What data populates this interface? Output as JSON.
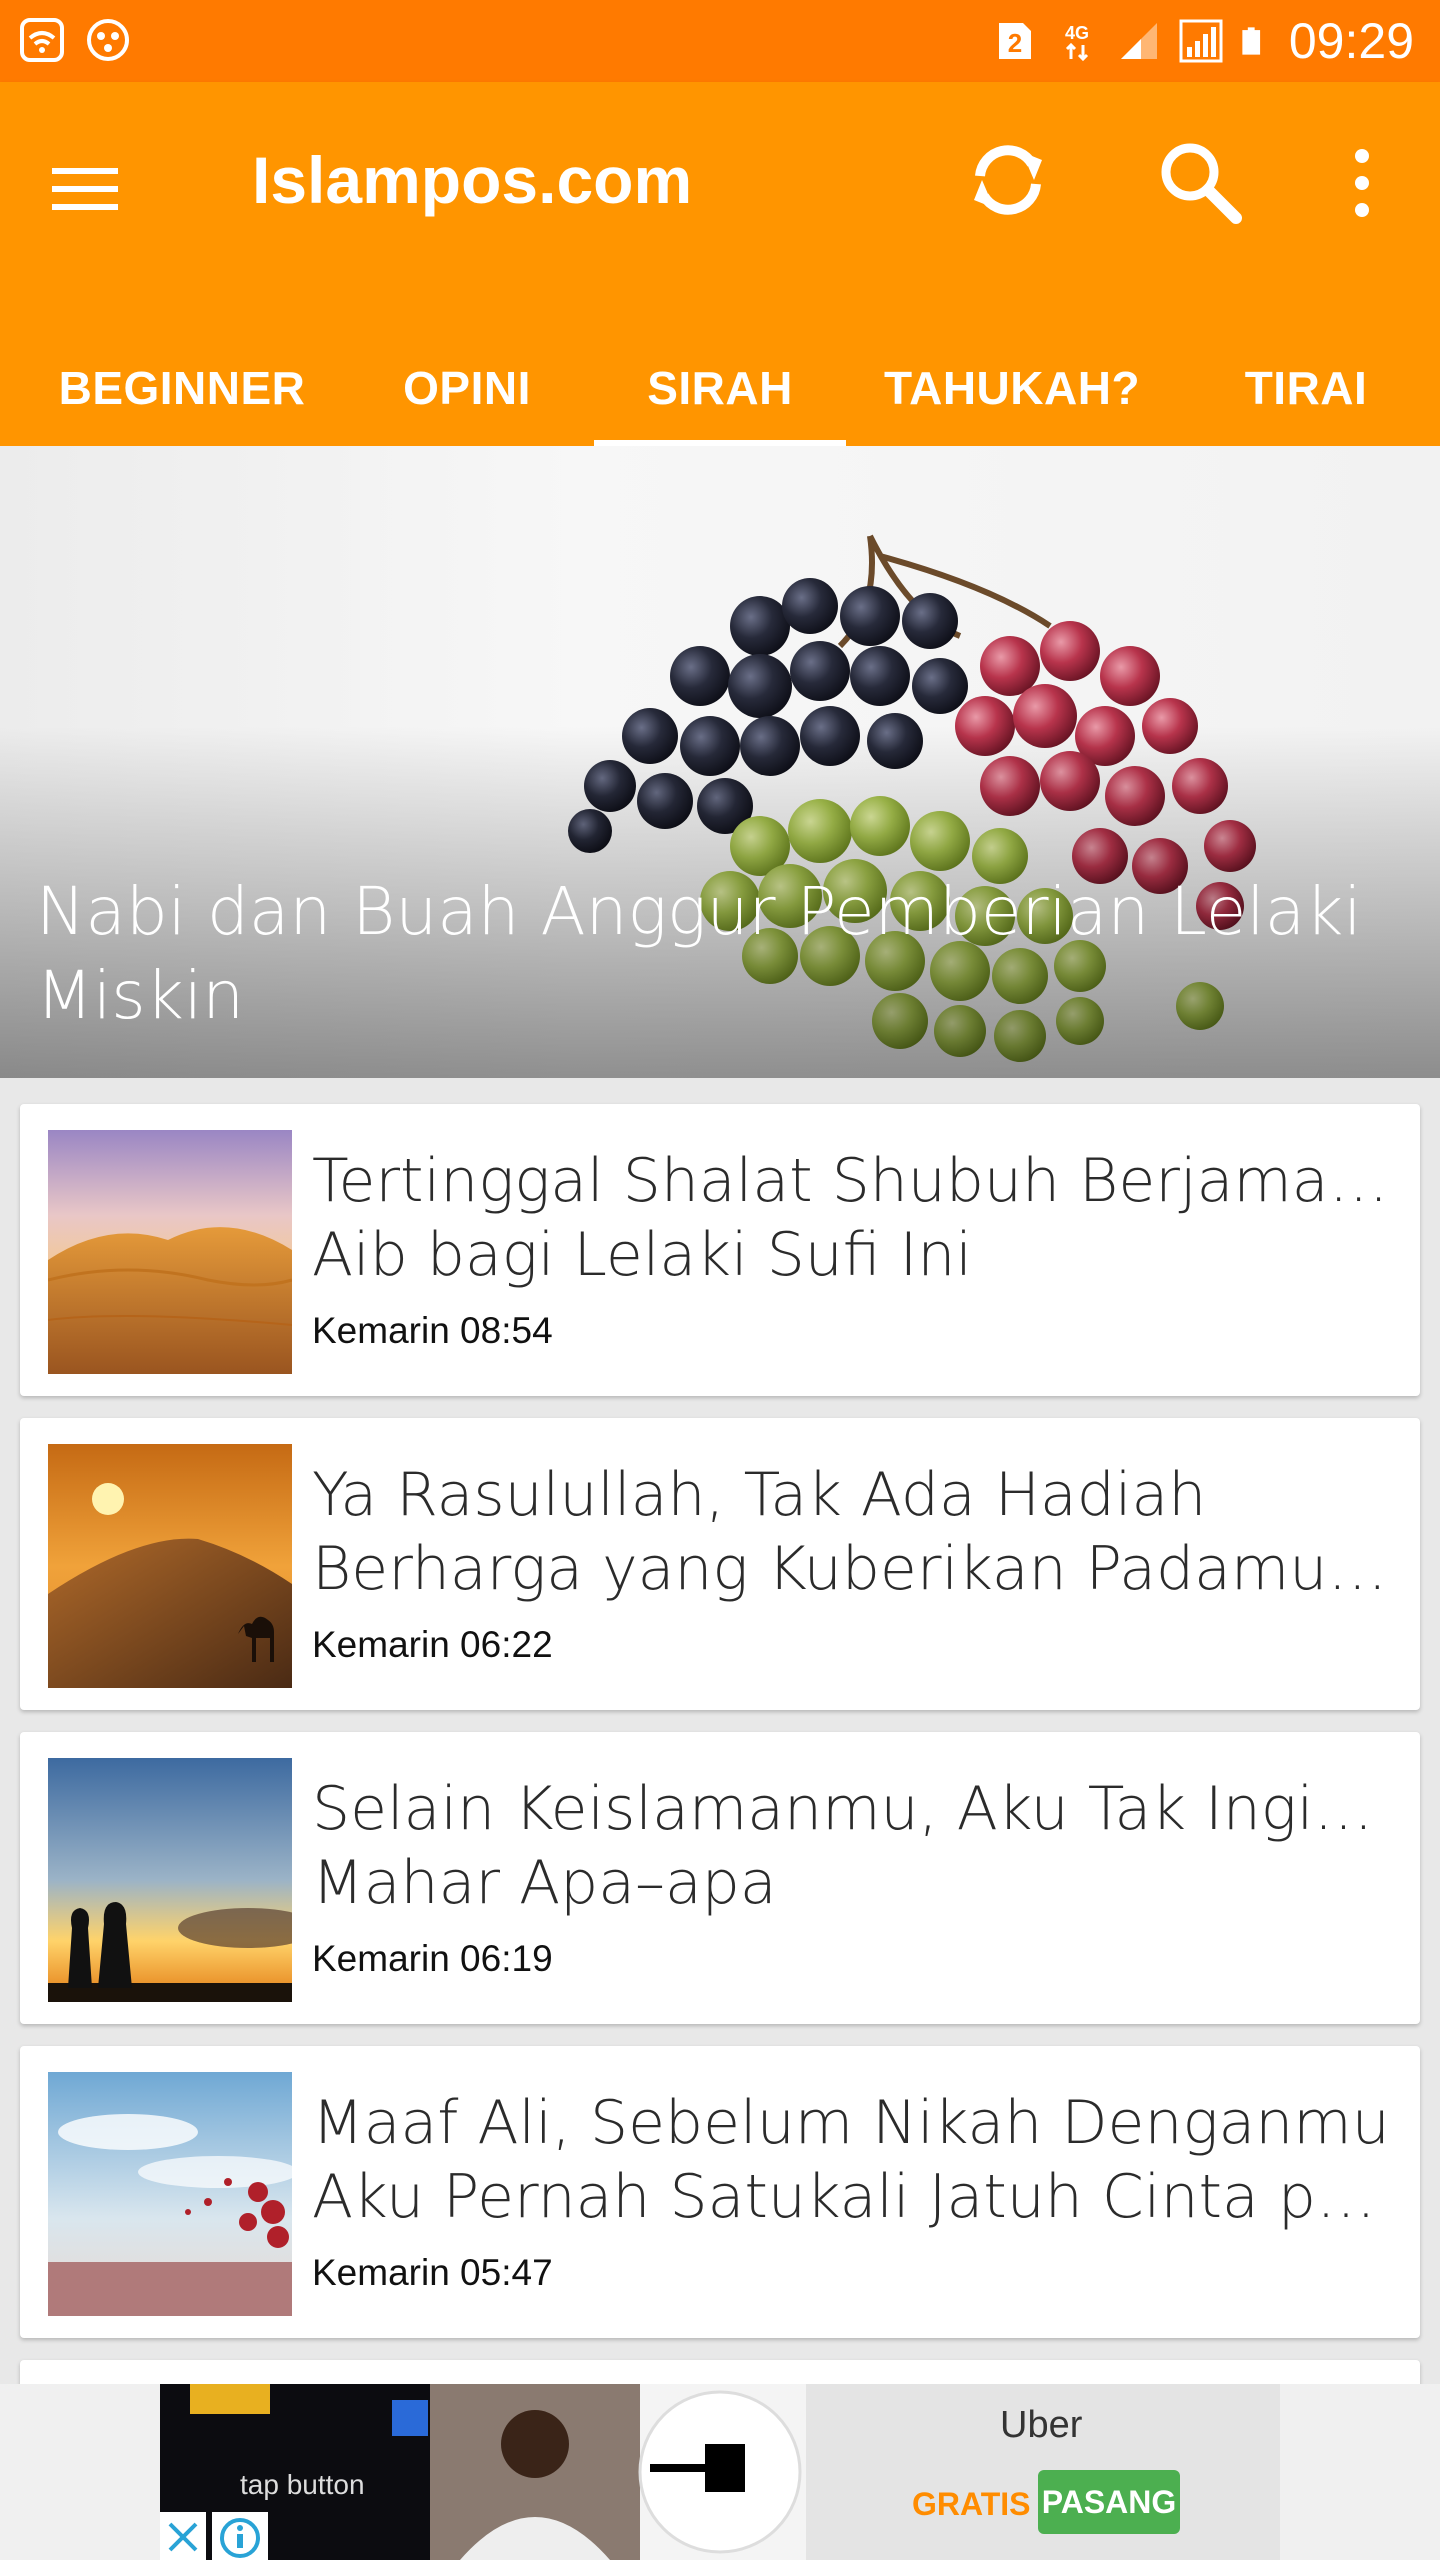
{
  "status_bar": {
    "time": "09:29",
    "sim_badge": "2",
    "network": "4G",
    "icons": [
      "wifi-icon",
      "sync-dots-icon",
      "sim-icon",
      "signal-icon",
      "signal-icon",
      "battery-icon"
    ]
  },
  "app_bar": {
    "title": "Islampos.com",
    "icons": [
      "menu-icon",
      "refresh-icon",
      "search-icon",
      "more-vert-icon"
    ]
  },
  "tabs": [
    {
      "label": "BEGINNER",
      "selected": false
    },
    {
      "label": "OPINI",
      "selected": false
    },
    {
      "label": "SIRAH",
      "selected": true
    },
    {
      "label": "TAHUKAH?",
      "selected": false
    },
    {
      "label": "TIRAI",
      "selected": false
    }
  ],
  "hero": {
    "title": "Nabi dan Buah Anggur Pemberian Lelaki Miskin"
  },
  "articles": [
    {
      "line1": "Tertinggal Shalat Shubuh Berjamaah,",
      "line2": "Aib bagi Lelaki Sufi Ini",
      "time": "Kemarin 08:54"
    },
    {
      "line1": "Ya Rasulullah, Tak Ada Hadiah",
      "line2": "Berharga yang Kuberikan Padamu Sel…",
      "time": "Kemarin 06:22"
    },
    {
      "line1": "Selain Keislamanmu, Aku Tak Inginkan",
      "line2": "Mahar Apa–apa",
      "time": "Kemarin 06:19"
    },
    {
      "line1": "Maaf Ali, Sebelum Nikah Denganmu",
      "line2": "Aku Pernah Satukali Jatuh Cinta pada…",
      "time": "Kemarin 05:47"
    }
  ],
  "ad": {
    "brand": "Uber",
    "free_label": "GRATIS",
    "install_label": "PASANG",
    "tap_text": "tap button",
    "colors": {
      "free": "#ff8c00",
      "install": "#4caf50"
    }
  },
  "colors": {
    "status_bar": "#ff7a00",
    "app_bar": "#ff9500"
  }
}
